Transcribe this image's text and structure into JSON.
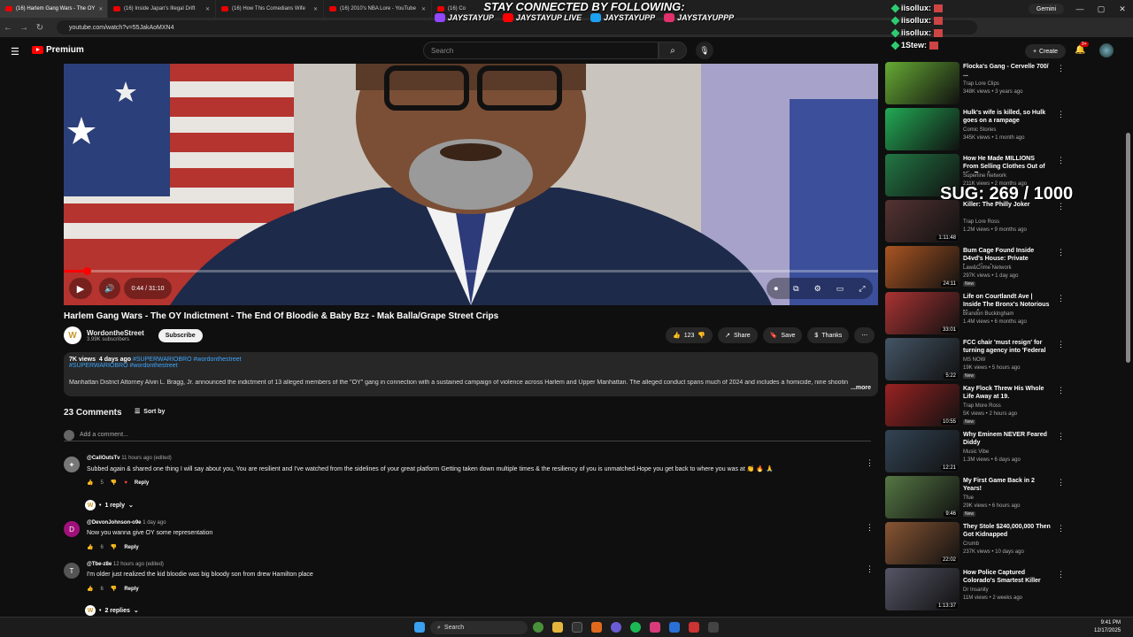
{
  "browser": {
    "tabs": [
      {
        "label": "(16) Harlem Gang Wars - The OY",
        "active": true
      },
      {
        "label": "(16) Inside Japan's Illegal Drift"
      },
      {
        "label": "(16) How This Comedians Wife"
      },
      {
        "label": "(16) 2010's NBA Lore - YouTube"
      },
      {
        "label": "(16) Co"
      }
    ],
    "url": "youtube.com/watch?v=55JakAoMXN4",
    "gemini_label": "Gemini"
  },
  "overlay": {
    "headline": "STAY CONNECTED BY FOLLOWING:",
    "socials": [
      {
        "label": "JAYSTAYUP",
        "icon": "twitch-icon",
        "color": "#9146ff"
      },
      {
        "label": "JAYSTAYUP LIVE",
        "icon": "youtube-icon",
        "color": "#ff0000"
      },
      {
        "label": "JAYSTAYUPP",
        "icon": "twitter-icon",
        "color": "#1da1f2"
      },
      {
        "label": "JAYSTAYUPPP",
        "icon": "instagram-icon",
        "color": "#e1306c"
      }
    ],
    "chat": [
      "iisollux:",
      "iisollux:",
      "iisollux:",
      "1Stew:"
    ],
    "sug_counter": "SUG: 269 / 1000"
  },
  "youtube": {
    "logo_text": "Premium",
    "search_placeholder": "Search",
    "create_label": "Create",
    "notif_badge": "9+"
  },
  "player": {
    "time": "0:44 / 31:10",
    "progress": 0.024
  },
  "video": {
    "title": "Harlem Gang Wars - The OY Indictment - The End Of Bloodie & Baby Bzz - Mak Balla/Grape Street Crips",
    "channel": "WordontheStreet",
    "subscribers": "3.99K subscribers",
    "subscribe_label": "Subscribe",
    "likes": "123",
    "share_label": "Share",
    "save_label": "Save",
    "thanks_label": "Thanks",
    "views": "7K views",
    "age": "4 days ago",
    "tags1": "#SUPERWARIOBRO #wordonthestreet",
    "tags2": "#SUPERWARIOBRO #wordonthestreet",
    "description": "Manhattan District Attorney Alvin L. Bragg, Jr. announced the indictment of 13 alleged members of the \"OY\" gang in connection with a sustained campaign of violence across Harlem and Upper Manhattan. The alleged conduct spans much of 2024 and includes a homicide, nine shootin",
    "more_label": "...more"
  },
  "comments": {
    "count_label": "23 Comments",
    "sort_label": "Sort by",
    "add_placeholder": "Add a comment...",
    "items": [
      {
        "user": "@CallOutsTv",
        "meta": "11 hours ago (edited)",
        "text": "Subbed again & shared one thing I will say about you, You are resilient and I've watched from the sidelines of your great platform Getting taken down multiple times & the resiliency of you is unmatched.Hope you get back to where you was at 👏 🔥 🙏",
        "likes": "5",
        "reply": "Reply"
      },
      {
        "user": "@DevonJohnson-o9e",
        "meta": "1 day ago",
        "text": "Now you wanna give OY some representation",
        "likes": "6",
        "reply": "Reply",
        "initial": "D"
      },
      {
        "user": "@Tbe-z8e",
        "meta": "12 hours ago (edited)",
        "text": "I'm older just realized the kid bloodie was big bloody son from drew Hamilton place",
        "likes": "6",
        "reply": "Reply",
        "initial": "T"
      }
    ],
    "reply_counts": [
      "1 reply",
      "2 replies"
    ]
  },
  "recommendations": [
    {
      "title": "Flocka's Gang - Cervelle 700/ ...",
      "channel": "Trap Lore Clips",
      "views": "348K views • 3 years ago",
      "duration": "",
      "new": ""
    },
    {
      "title": "Hulk's wife is killed, so Hulk goes on a rampage",
      "channel": "Comic Stories",
      "views": "345K views • 1 month ago",
      "duration": "",
      "new": ""
    },
    {
      "title": "How He Made MILLIONS From Selling Clothes Out of His Trunk",
      "channel": "Superline Network",
      "views": "211K views • 2 months ago",
      "duration": "",
      "new": ""
    },
    {
      "title": "Killer: The Philly Joker",
      "channel": "Trap Lore Ross",
      "views": "1.2M views • 9 months ago",
      "duration": "1:11:48",
      "new": ""
    },
    {
      "title": "Bum Cage Found Inside D4vd's House: Private Investigator",
      "channel": "Law&Crime Network",
      "views": "297K views • 1 day ago",
      "duration": "24:11",
      "new": "New"
    },
    {
      "title": "Life on Courtlandt Ave | Inside The Bronx's Notorious Hood",
      "channel": "Brandon Buckingham",
      "views": "1.4M views • 6 months ago",
      "duration": "33:01",
      "new": ""
    },
    {
      "title": "FCC chair 'must resign' for turning agency into 'Federal ...",
      "channel": "MS NOW",
      "views": "19K views • 5 hours ago",
      "duration": "5:22",
      "new": "New"
    },
    {
      "title": "Kay Flock Threw His Whole Life Away at 19.",
      "channel": "Trap More Ross",
      "views": "5K views • 2 hours ago",
      "duration": "10:55",
      "new": "New"
    },
    {
      "title": "Why Eminem NEVER Feared Diddy",
      "channel": "Music Vibe",
      "views": "1.3M views • 6 days ago",
      "duration": "12:21",
      "new": ""
    },
    {
      "title": "My First Game Back in 2 Years!",
      "channel": "Tfue",
      "views": "29K views • 6 hours ago",
      "duration": "9:46",
      "new": "New"
    },
    {
      "title": "They Stole $240,000,000 Then Got Kidnapped",
      "channel": "Crumb",
      "views": "237K views • 10 days ago",
      "duration": "22:02",
      "new": ""
    },
    {
      "title": "How Police Captured Colorado's Smartest Killer",
      "channel": "Dr Insanity",
      "views": "11M views • 2 weeks ago",
      "duration": "1:13:37",
      "new": ""
    }
  ],
  "taskbar": {
    "search_label": "Search",
    "time": "9:41 PM",
    "date": "12/17/2025"
  }
}
